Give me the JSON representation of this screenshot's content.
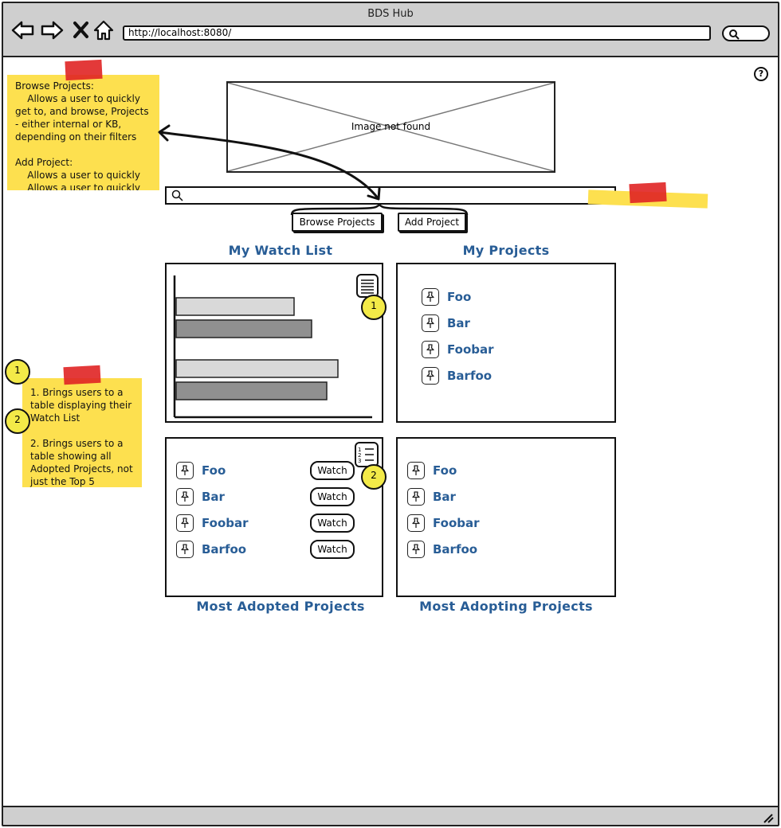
{
  "browser": {
    "title": "BDS Hub",
    "url": "http://localhost:8080/"
  },
  "header": {
    "image_placeholder": "Image not found",
    "help_label": "?"
  },
  "search": {
    "placeholder": ""
  },
  "actions": {
    "browse_projects": "Browse Projects",
    "add_project": "Add Project"
  },
  "watch_list": {
    "title": "My Watch List",
    "chart_data": {
      "type": "bar",
      "orientation": "horizontal",
      "categories": [
        "",
        ""
      ],
      "series": [
        {
          "color": "#d9d9d9",
          "values": [
            148,
            203
          ]
        },
        {
          "color": "#909090",
          "values": [
            170,
            189
          ]
        }
      ]
    }
  },
  "my_projects": {
    "title": "My Projects",
    "items": [
      "Foo",
      "Bar",
      "Foobar",
      "Barfoo"
    ]
  },
  "most_adopted": {
    "title": "Most Adopted Projects",
    "items": [
      "Foo",
      "Bar",
      "Foobar",
      "Barfoo"
    ],
    "watch_label": "Watch"
  },
  "most_adopting": {
    "title": "Most Adopting Projects",
    "items": [
      "Foo",
      "Bar",
      "Foobar",
      "Barfoo"
    ]
  },
  "notes": {
    "top": {
      "lines": [
        "Browse Projects:",
        "    Allows a user to quickly",
        "get to, and browse, Projects",
        "- either internal or KB,",
        "depending on their filters",
        "",
        "Add Project:",
        "    Allows a user to quickly",
        "    Allows a user to quickly"
      ]
    },
    "side": {
      "lines": [
        "1. Brings users to a",
        "table displaying their",
        "Watch List",
        "",
        "2. Brings users to a",
        "table showing all",
        "Adopted Projects, not",
        "just the Top 5"
      ]
    }
  },
  "badges": [
    "1",
    "2"
  ],
  "colors": {
    "link": "#285d96",
    "sticky": "#fde04f",
    "tape": "#e02424",
    "chrome": "#cfcfcf"
  }
}
